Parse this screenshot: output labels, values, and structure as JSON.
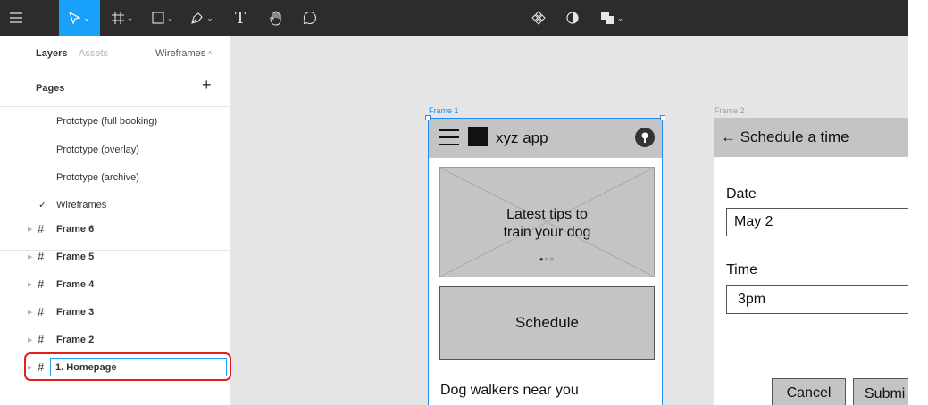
{
  "toolbar": {
    "tools": [
      "menu-icon",
      "move-tool-icon",
      "frame-tool-icon",
      "shape-tool-icon",
      "pen-tool-icon",
      "text-tool-icon",
      "hand-tool-icon",
      "comment-tool-icon"
    ],
    "center_tools": [
      "component-icon",
      "mask-icon",
      "boolean-icon"
    ],
    "text_tool_glyph": "T"
  },
  "panel": {
    "tab_layers": "Layers",
    "tab_assets": "Assets",
    "current_page": "Wireframes",
    "pages_label": "Pages",
    "add_page_glyph": "+",
    "pages": [
      {
        "label": "Prototype (full booking)",
        "checked": false
      },
      {
        "label": "Prototype (overlay)",
        "checked": false
      },
      {
        "label": "Prototype (archive)",
        "checked": false
      },
      {
        "label": "Wireframes",
        "checked": true
      }
    ],
    "check_glyph": "✓",
    "layers": [
      {
        "label": "Frame 6"
      },
      {
        "label": "Frame 5"
      },
      {
        "label": "Frame 4"
      },
      {
        "label": "Frame 3"
      },
      {
        "label": "Frame 2"
      },
      {
        "label": "1. Homepage",
        "editing": true
      }
    ],
    "hash_glyph": "#"
  },
  "canvas": {
    "frame1": {
      "label": "Frame 1",
      "app_name": "xyz app",
      "carousel_text_1": "Latest tips to",
      "carousel_text_2": "train your dog",
      "carousel_dots": "●○○",
      "schedule_button": "Schedule",
      "section_title": "Dog walkers near you"
    },
    "frame2": {
      "label": "Frame 2",
      "title": "← Schedule a time",
      "date_label": "Date",
      "date_value": "May 2",
      "time_label": "Time",
      "time_value": "3pm",
      "cancel_button": "Cancel",
      "submit_button": "Submi"
    }
  },
  "colors": {
    "accent": "#18a0fb",
    "toolbar_bg": "#2c2c2c",
    "canvas_bg": "#e5e5e5",
    "wire_gray": "#c4c4c4",
    "highlight_red": "#e0201b"
  }
}
